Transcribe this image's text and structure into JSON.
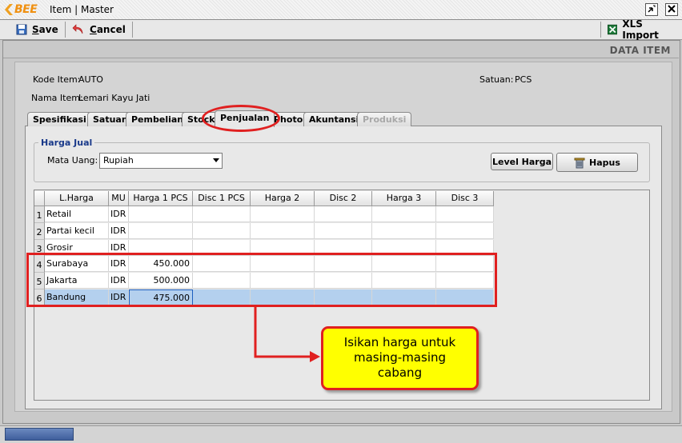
{
  "window": {
    "brand": "BEE",
    "title": "Item | Master"
  },
  "toolbar": {
    "save": "Save",
    "cancel": "Cancel",
    "import": "XLS Import"
  },
  "section_title": "DATA ITEM",
  "fields": {
    "kode_label": "Kode Item:",
    "kode_value": "AUTO",
    "nama_label": "Nama Item:",
    "nama_value": "Lemari Kayu Jati",
    "satuan_label": "Satuan:",
    "satuan_value": "PCS"
  },
  "tabs": [
    "Spesifikasi",
    "Satuan",
    "Pembelian",
    "Stock",
    "Penjualan",
    "Photo",
    "Akuntansi",
    "Produksi"
  ],
  "active_tab": "Penjualan",
  "harga_jual": {
    "legend": "Harga Jual",
    "mata_uang_label": "Mata Uang:",
    "mata_uang_value": "Rupiah",
    "level_button": "Level Harga",
    "hapus_button": "Hapus"
  },
  "table": {
    "columns": [
      "L.Harga",
      "MU",
      "Harga 1 PCS",
      "Disc 1 PCS",
      "Harga 2",
      "Disc 2",
      "Harga 3",
      "Disc 3"
    ],
    "rows": [
      {
        "no": "1",
        "lharga": "Retail",
        "mu": "IDR",
        "harga1": ""
      },
      {
        "no": "2",
        "lharga": "Partai kecil",
        "mu": "IDR",
        "harga1": ""
      },
      {
        "no": "3",
        "lharga": "Grosir",
        "mu": "IDR",
        "harga1": ""
      },
      {
        "no": "4",
        "lharga": "Surabaya",
        "mu": "IDR",
        "harga1": "450.000"
      },
      {
        "no": "5",
        "lharga": "Jakarta",
        "mu": "IDR",
        "harga1": "500.000"
      },
      {
        "no": "6",
        "lharga": "Bandung",
        "mu": "IDR",
        "harga1": "475.000"
      }
    ]
  },
  "callout": {
    "line1": "Isikan harga untuk",
    "line2": "masing-masing",
    "line3": "cabang"
  },
  "colors": {
    "annotation_red": "#e02020",
    "callout_yellow": "#ffff00",
    "selection": "#b4d0ee"
  }
}
